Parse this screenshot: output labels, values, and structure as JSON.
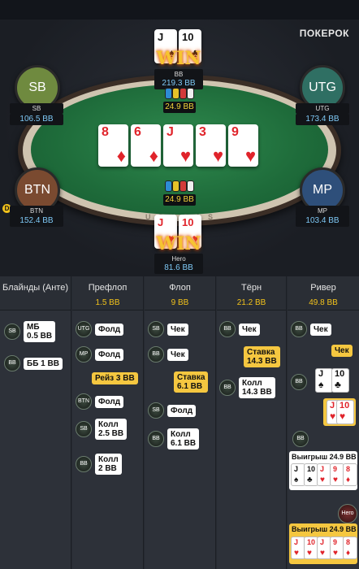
{
  "brand": "ПОКЕРОК",
  "table": {
    "rail_text": "USHCAS"
  },
  "players": {
    "bb": {
      "name": "BB",
      "stack": "219.3 BB",
      "cards": [
        {
          "rank": "J",
          "suit": "♠"
        },
        {
          "rank": "10",
          "suit": "♣"
        }
      ],
      "win": "WIN"
    },
    "sb": {
      "seat": "SB",
      "name": "SB",
      "stack": "106.5 BB"
    },
    "utg": {
      "seat": "UTG",
      "name": "UTG",
      "stack": "173.4 BB"
    },
    "btn": {
      "seat": "BTN",
      "name": "BTN",
      "stack": "152.4 BB"
    },
    "mp": {
      "seat": "MP",
      "name": "MP",
      "stack": "103.4 BB"
    },
    "hero": {
      "name": "Hero",
      "stack": "81.6 BB",
      "cards": [
        {
          "rank": "J",
          "suit": "♥"
        },
        {
          "rank": "10",
          "suit": "♥"
        }
      ],
      "win": "WIN"
    }
  },
  "pots": {
    "top": "24.9 BB",
    "center": "24.9 BB"
  },
  "board": [
    {
      "rank": "8",
      "suit": "♦",
      "color": "red"
    },
    {
      "rank": "6",
      "suit": "♦",
      "color": "red"
    },
    {
      "rank": "J",
      "suit": "♥",
      "color": "red"
    },
    {
      "rank": "3",
      "suit": "♥",
      "color": "red"
    },
    {
      "rank": "9",
      "suit": "♥",
      "color": "red"
    }
  ],
  "history": {
    "columns": [
      {
        "title": "Блайнды (Анте)",
        "value": ""
      },
      {
        "title": "Префлоп",
        "value": "1.5 BB"
      },
      {
        "title": "Флоп",
        "value": "9 BB"
      },
      {
        "title": "Тёрн",
        "value": "21.2 BB"
      },
      {
        "title": "Ривер",
        "value": "49.8 BB"
      }
    ],
    "blinds": [
      {
        "pos": "SB",
        "text": "МБ\n0.5 BB"
      },
      {
        "pos": "BB",
        "text": "ББ 1 BB"
      }
    ],
    "preflop": [
      {
        "pos": "UTG",
        "text": "Фолд"
      },
      {
        "pos": "MP",
        "text": "Фолд"
      },
      {
        "text": "Рейз 3 BB"
      },
      {
        "pos": "BTN",
        "text": "Фолд"
      },
      {
        "pos": "SB",
        "text": "Колл\n2.5 BB"
      },
      {
        "pos": "BB",
        "text": "Колл\n2 BB"
      }
    ],
    "flop": [
      {
        "pos": "SB",
        "text": "Чек"
      },
      {
        "pos": "BB",
        "text": "Чек"
      },
      {
        "text": "Ставка\n6.1 BB"
      },
      {
        "pos": "SB",
        "text": "Фолд"
      },
      {
        "pos": "BB",
        "text": "Колл\n6.1 BB"
      }
    ],
    "turn": [
      {
        "pos": "BB",
        "text": "Чек"
      },
      {
        "text": "Ставка\n14.3 BB"
      },
      {
        "pos": "BB",
        "text": "Колл\n14.3 BB"
      }
    ],
    "river": [
      {
        "pos": "BB",
        "text": "Чек"
      },
      {
        "text": "Чек"
      },
      {
        "pos": "BB"
      },
      {
        "pos": "BB",
        "label": "Выигрыш 24.9 BB"
      },
      {
        "pos": "Hero",
        "label": "Выигрыш 24.9 BB"
      }
    ]
  }
}
